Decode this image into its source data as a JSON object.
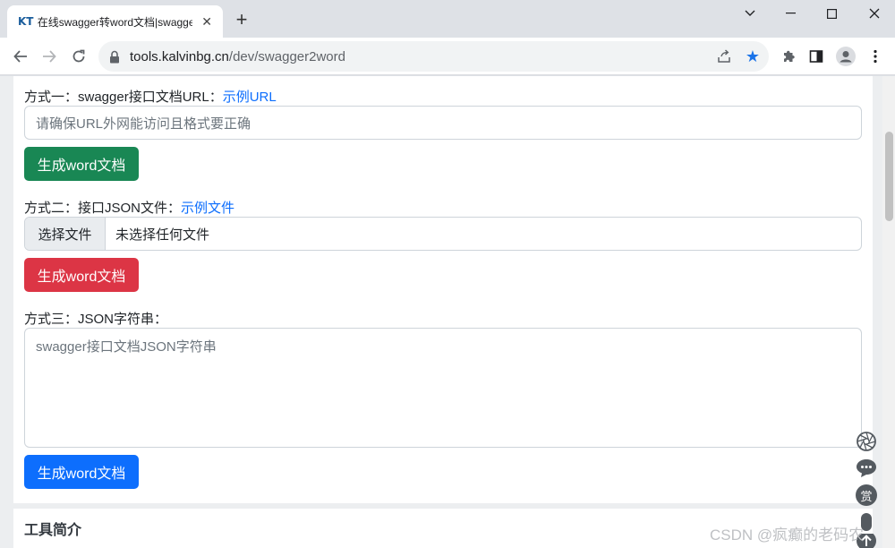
{
  "browser": {
    "tab_favicon_text": "KT",
    "tab_title": "在线swagger转word文档|swagger",
    "url_host": "tools.kalvinbg.cn",
    "url_path": "/dev/swagger2word"
  },
  "form": {
    "method1_label": "方式一：swagger接口文档URL：",
    "method1_link": "示例URL",
    "url_placeholder": "请确保URL外网能访问且格式要正确",
    "method2_label": "方式二：接口JSON文件：",
    "method2_link": "示例文件",
    "file_button": "选择文件",
    "file_status": "未选择任何文件",
    "method3_label": "方式三：JSON字符串：",
    "json_placeholder": "swagger接口文档JSON字符串",
    "generate_label": "生成word文档"
  },
  "section2": {
    "title": "工具简介"
  },
  "floating": {
    "reward_label": "赏"
  },
  "watermark": "CSDN @疯癫的老码农",
  "colors": {
    "green_button": "#198754",
    "red_button": "#dc3545",
    "blue_button": "#0d6efd",
    "link": "#0d6efd",
    "star": "#1a73e8"
  }
}
